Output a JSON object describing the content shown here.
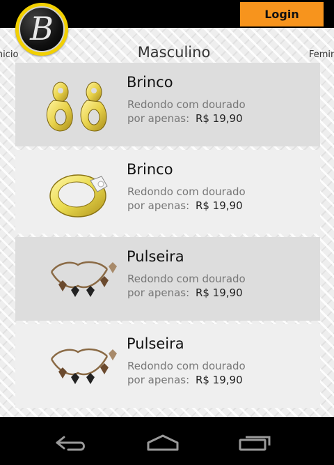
{
  "header": {
    "login_label": "Login",
    "logo_letter": "B"
  },
  "nav": {
    "left": "Inicio",
    "center": "Masculino",
    "right": "Feminino"
  },
  "products": [
    {
      "title": "Brinco",
      "description": "Redondo com dourado",
      "price_label": "por apenas:",
      "price": "R$ 19,90",
      "image": "earrings-image"
    },
    {
      "title": "Brinco",
      "description": "Redondo com dourado",
      "price_label": "por apenas:",
      "price": "R$ 19,90",
      "image": "ring-image"
    },
    {
      "title": "Pulseira",
      "description": "Redondo com dourado",
      "price_label": "por apenas:",
      "price": "R$ 19,90",
      "image": "bracelet-image"
    },
    {
      "title": "Pulseira",
      "description": "Redondo com dourado",
      "price_label": "por apenas:",
      "price": "R$ 19,90",
      "image": "bracelet-image"
    }
  ],
  "system_nav": {
    "back_icon": "back-icon",
    "home_icon": "home-icon",
    "recents_icon": "recent-apps-icon"
  },
  "colors": {
    "accent": "#f7941d",
    "logo_ring": "#f2d000"
  }
}
